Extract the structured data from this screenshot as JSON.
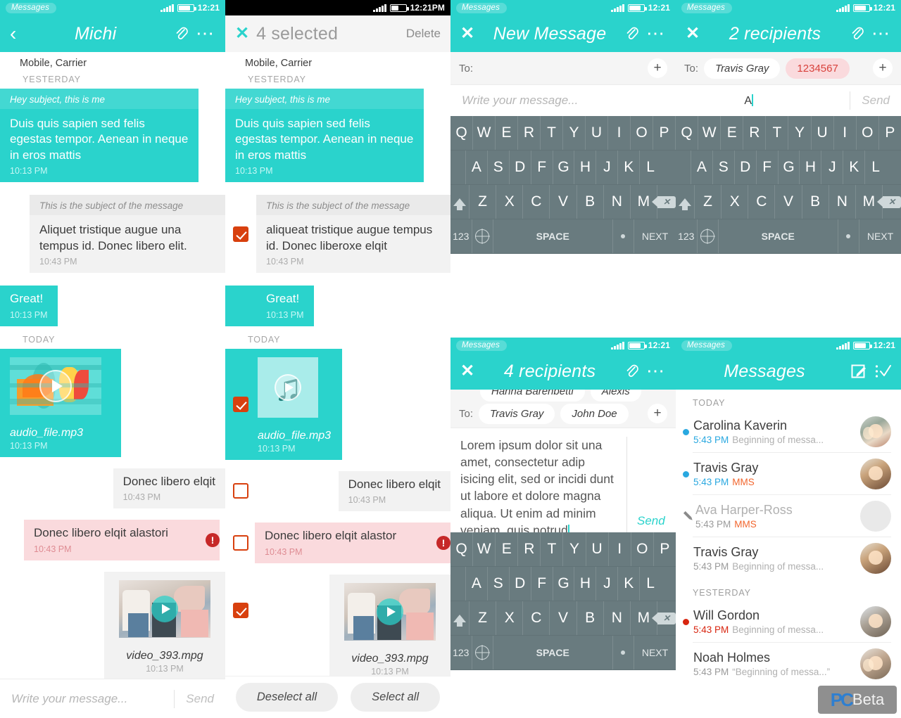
{
  "status_bar": {
    "app_label": "Messages",
    "time_teal": "12:21",
    "time_black": "12:21PM"
  },
  "panel_thread": {
    "appbar": {
      "title": "Michi",
      "back_icon": "chevron-left-icon",
      "attach_icon": "paperclip-icon",
      "more_icon": "overflow-dots-icon"
    },
    "carrier": "Mobile, Carrier",
    "day_yesterday": "YESTERDAY",
    "day_today": "TODAY",
    "messages": [
      {
        "subject": "Hey subject, this is me",
        "text": "Duis quis sapien sed felis egestas tempor. Aenean in neque in eros mattis",
        "time": "10:13 PM",
        "side": "out",
        "kind": "teal"
      },
      {
        "subject": "This is the subject of the message",
        "text": "Aliquet tristique augue una tempus id. Donec libero elit.",
        "time": "10:43 PM",
        "side": "in",
        "kind": "gray"
      },
      {
        "text": "Great!",
        "time": "10:13 PM",
        "side": "out",
        "kind": "teal"
      },
      {
        "filename": "audio_file.mp3",
        "time": "10:13 PM",
        "side": "out",
        "kind": "teal",
        "media": "audio"
      },
      {
        "text": "Donec libero elqit",
        "time": "10:43 PM",
        "side": "in",
        "kind": "gray"
      },
      {
        "text": "Donec libero elqit alastori",
        "time": "10:43 PM",
        "side": "in",
        "kind": "error",
        "error_icon": "error-exclamation-icon"
      },
      {
        "filename": "video_393.mpg",
        "time": "10:13 PM",
        "side": "in",
        "kind": "gray",
        "media": "video"
      }
    ],
    "composer": {
      "placeholder": "Write your message...",
      "send_label": "Send"
    }
  },
  "panel_select": {
    "appbar": {
      "close_icon": "close-x-icon",
      "title": "4 selected",
      "delete_label": "Delete"
    },
    "carrier": "Mobile, Carrier",
    "day_yesterday": "YESTERDAY",
    "day_today": "TODAY",
    "messages": [
      {
        "subject": "Hey subject, this is me",
        "text": "Duis quis sapien sed felis egestas tempor. Aenean in neque in eros mattis",
        "time": "10:13 PM",
        "side": "out",
        "kind": "teal",
        "checked": true
      },
      {
        "subject": "This is the subject of the message",
        "text": "aliqueat tristique augue tempus id. Donec liberoxe elqit",
        "time": "10:43 PM",
        "side": "in",
        "kind": "gray",
        "checked": true
      },
      {
        "text": "Great!",
        "time": "10:13 PM",
        "side": "out",
        "kind": "teal",
        "checked": false
      },
      {
        "filename": "audio_file.mp3",
        "time": "10:13 PM",
        "side": "out",
        "kind": "teal",
        "media": "audio-note",
        "checked": true
      },
      {
        "text": "Donec libero elqit",
        "time": "10:43 PM",
        "side": "in",
        "kind": "gray",
        "checked": false
      },
      {
        "text": "Donec libero elqit alastor",
        "time": "10:43 PM",
        "side": "in",
        "kind": "error",
        "checked": false,
        "error_icon": "error-exclamation-icon"
      },
      {
        "filename": "video_393.mpg",
        "time": "10:13 PM",
        "side": "in",
        "kind": "gray",
        "media": "video",
        "checked": true
      }
    ],
    "footer": {
      "deselect_label": "Deselect all",
      "select_label": "Select all"
    }
  },
  "panel_new_message": {
    "appbar": {
      "close_icon": "close-x-icon",
      "title": "New Message",
      "attach_icon": "paperclip-icon",
      "more_icon": "overflow-dots-icon"
    },
    "to_label": "To:",
    "add_icon": "plus-icon",
    "composer": {
      "placeholder": "Write your message...",
      "send_label": "Send"
    },
    "keyboard": {
      "row1": [
        "Q",
        "W",
        "E",
        "R",
        "T",
        "Y",
        "U",
        "I",
        "O",
        "P"
      ],
      "row2": [
        "A",
        "S",
        "D",
        "F",
        "G",
        "H",
        "J",
        "K",
        "L"
      ],
      "row3": [
        "Z",
        "X",
        "C",
        "V",
        "B",
        "N",
        "M"
      ],
      "num_label": "123",
      "space_label": "SPACE",
      "next_label": "NEXT",
      "shift_icon": "shift-arrow-icon",
      "backspace_icon": "backspace-icon",
      "globe_icon": "globe-language-icon",
      "period_icon": "period-key-icon"
    }
  },
  "panel_two_recipients": {
    "appbar": {
      "close_icon": "close-x-icon",
      "title": "2 recipients",
      "attach_icon": "paperclip-icon",
      "more_icon": "overflow-dots-icon"
    },
    "to_label": "To:",
    "chips": [
      {
        "label": "Travis Gray",
        "invalid": false
      },
      {
        "label": "1234567",
        "invalid": true
      }
    ],
    "add_icon": "plus-icon",
    "composer": {
      "value": "A",
      "send_label": "Send"
    },
    "keyboard": {
      "row1": [
        "Q",
        "W",
        "E",
        "R",
        "T",
        "Y",
        "U",
        "I",
        "O",
        "P"
      ],
      "row2": [
        "A",
        "S",
        "D",
        "F",
        "G",
        "H",
        "J",
        "K",
        "L"
      ],
      "row3": [
        "Z",
        "X",
        "C",
        "V",
        "B",
        "N",
        "M"
      ],
      "num_label": "123",
      "space_label": "SPACE",
      "next_label": "NEXT"
    }
  },
  "panel_four_recipients": {
    "appbar": {
      "close_icon": "close-x-icon",
      "title": "4 recipients",
      "attach_icon": "paperclip-icon",
      "more_icon": "overflow-dots-icon"
    },
    "to_label": "To:",
    "chips_overflow": [
      {
        "label": "Hanna Barenbetti"
      },
      {
        "label": "Alexis"
      }
    ],
    "chips": [
      {
        "label": "Travis Gray"
      },
      {
        "label": "John Doe"
      }
    ],
    "add_icon": "plus-icon",
    "editor": {
      "text": "Lorem ipsum dolor sit una amet, consectetur adip isicing elit, sed or incidi dunt ut labore et dolore magna aliqua. Ut enim ad minim veniam, quis notrud",
      "send_label": "Send"
    },
    "keyboard": {
      "row1": [
        "Q",
        "W",
        "E",
        "R",
        "T",
        "Y",
        "U",
        "I",
        "O",
        "P"
      ],
      "row2": [
        "A",
        "S",
        "D",
        "F",
        "G",
        "H",
        "J",
        "K",
        "L"
      ],
      "row3": [
        "Z",
        "X",
        "C",
        "V",
        "B",
        "N",
        "M"
      ],
      "num_label": "123",
      "space_label": "SPACE",
      "next_label": "NEXT"
    }
  },
  "panel_conversations": {
    "appbar": {
      "title": "Messages",
      "compose_icon": "compose-pencil-icon",
      "select_icon": "checklist-icon"
    },
    "groups": [
      {
        "label": "TODAY",
        "items": [
          {
            "name": "Carolina Kaverin",
            "time": "5:43 PM",
            "preview": "Beginning of messa...",
            "badge": "",
            "unread": "blue",
            "state": "unread"
          },
          {
            "name": "Travis Gray",
            "time": "5:43 PM",
            "preview": "",
            "badge": "MMS",
            "unread": "blue",
            "state": "unread"
          },
          {
            "name": "Ava Harper-Ross",
            "time": "5:43 PM",
            "preview": "",
            "badge": "MMS",
            "unread": "draft",
            "state": "draft"
          },
          {
            "name": "Travis Gray",
            "time": "5:43 PM",
            "preview": "Beginning of messa...",
            "badge": "",
            "unread": "none",
            "state": "read"
          }
        ]
      },
      {
        "label": "YESTERDAY",
        "items": [
          {
            "name": "Will Gordon",
            "time": "5:43 PM",
            "preview": "Beginning of messa...",
            "badge": "",
            "unread": "red",
            "state": "failed"
          },
          {
            "name": "Noah Holmes",
            "time": "5:43 PM",
            "preview": "“Beginning of messa...”",
            "badge": "",
            "unread": "none",
            "state": "read"
          }
        ]
      }
    ]
  },
  "watermark": {
    "brand": "PC",
    "suffix": "Beta"
  },
  "colors": {
    "teal": "#2AD3CC",
    "error_red": "#D8400E",
    "pink": "#FADADD",
    "keyboard": "#697B7F",
    "blue_dot": "#29A8E0",
    "mms_orange": "#F2662E"
  }
}
